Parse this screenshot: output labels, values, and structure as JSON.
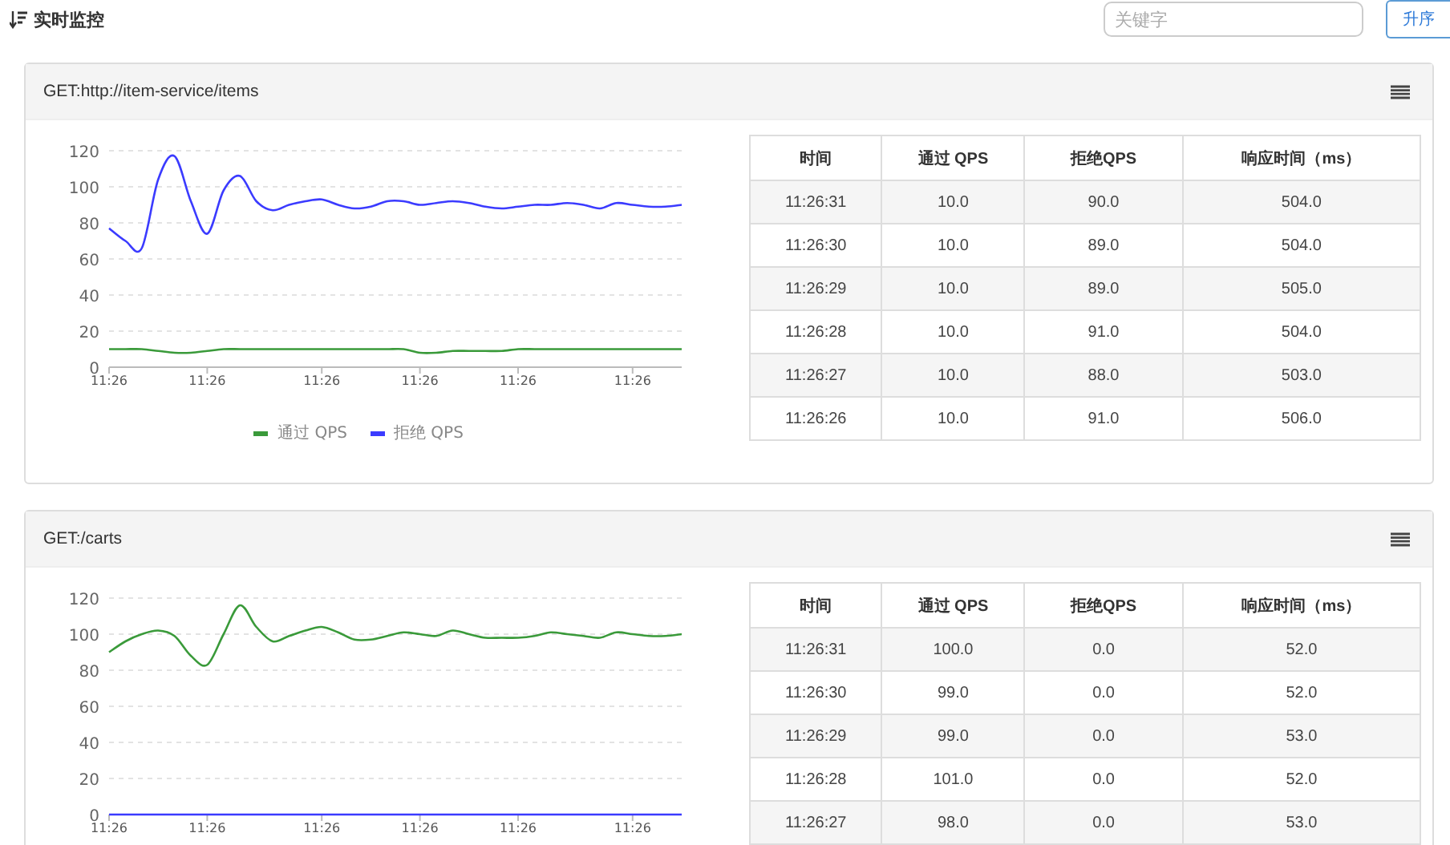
{
  "header": {
    "title": "实时监控",
    "search": {
      "placeholder": "关键字"
    },
    "sort_button": "升序"
  },
  "resources": [
    {
      "name": "GET:http://item-service/items",
      "chart_data": {
        "type": "line",
        "grid": true,
        "categories": [
          "11:26",
          null,
          null,
          null,
          null,
          null,
          "11:26",
          null,
          null,
          null,
          null,
          null,
          null,
          "11:26",
          null,
          null,
          null,
          null,
          null,
          "11:26",
          null,
          null,
          null,
          null,
          null,
          "11:26",
          null,
          null,
          null,
          null,
          null,
          null,
          "11:26",
          null,
          null,
          null
        ],
        "ylim": [
          0,
          120
        ],
        "yticks": [
          0,
          20,
          40,
          60,
          80,
          100,
          120
        ],
        "series": [
          {
            "name": "通过 QPS",
            "color": "#3a9a3a",
            "values": [
              10,
              10,
              10,
              9,
              8,
              8,
              9,
              10,
              10,
              10,
              10,
              10,
              10,
              10,
              10,
              10,
              10,
              10,
              10,
              8,
              8,
              9,
              9,
              9,
              9,
              10,
              10,
              10,
              10,
              10,
              10,
              10,
              10,
              10,
              10,
              10
            ]
          },
          {
            "name": "拒绝 QPS",
            "color": "#3b3bff",
            "values": [
              77,
              70,
              66,
              104,
              117,
              92,
              74,
              98,
              106,
              92,
              87,
              90,
              92,
              93,
              90,
              88,
              89,
              92,
              92,
              90,
              91,
              92,
              91,
              89,
              88,
              89,
              90,
              90,
              91,
              90,
              88,
              91,
              90,
              89,
              89,
              90
            ]
          }
        ]
      },
      "table": {
        "columns": [
          "时间",
          "通过 QPS",
          "拒绝QPS",
          "响应时间（ms）"
        ],
        "rows": [
          [
            "11:26:31",
            "10.0",
            "90.0",
            "504.0"
          ],
          [
            "11:26:30",
            "10.0",
            "89.0",
            "504.0"
          ],
          [
            "11:26:29",
            "10.0",
            "89.0",
            "505.0"
          ],
          [
            "11:26:28",
            "10.0",
            "91.0",
            "504.0"
          ],
          [
            "11:26:27",
            "10.0",
            "88.0",
            "503.0"
          ],
          [
            "11:26:26",
            "10.0",
            "91.0",
            "506.0"
          ]
        ]
      }
    },
    {
      "name": "GET:/carts",
      "chart_data": {
        "type": "line",
        "grid": true,
        "categories": [
          "11:26",
          null,
          null,
          null,
          null,
          null,
          "11:26",
          null,
          null,
          null,
          null,
          null,
          null,
          "11:26",
          null,
          null,
          null,
          null,
          null,
          "11:26",
          null,
          null,
          null,
          null,
          null,
          "11:26",
          null,
          null,
          null,
          null,
          null,
          null,
          "11:26",
          null,
          null,
          null
        ],
        "ylim": [
          0,
          120
        ],
        "yticks": [
          0,
          20,
          40,
          60,
          80,
          100,
          120
        ],
        "series": [
          {
            "color": "#3a9a3a",
            "values": [
              90,
              96,
              100,
              102,
              99,
              88,
              83,
              100,
              116,
              104,
              96,
              99,
              102,
              104,
              101,
              97,
              97,
              99,
              101,
              100,
              99,
              102,
              100,
              98,
              98,
              98,
              99,
              101,
              100,
              99,
              98,
              101,
              100,
              99,
              99,
              100
            ]
          },
          {
            "color": "#3b3bff",
            "values": [
              0,
              0,
              0,
              0,
              0,
              0,
              0,
              0,
              0,
              0,
              0,
              0,
              0,
              0,
              0,
              0,
              0,
              0,
              0,
              0,
              0,
              0,
              0,
              0,
              0,
              0,
              0,
              0,
              0,
              0,
              0,
              0,
              0,
              0,
              0,
              0
            ]
          }
        ]
      },
      "table": {
        "columns": [
          "时间",
          "通过 QPS",
          "拒绝QPS",
          "响应时间（ms）"
        ],
        "rows": [
          [
            "11:26:31",
            "100.0",
            "0.0",
            "52.0"
          ],
          [
            "11:26:30",
            "99.0",
            "0.0",
            "52.0"
          ],
          [
            "11:26:29",
            "99.0",
            "0.0",
            "53.0"
          ],
          [
            "11:26:28",
            "101.0",
            "0.0",
            "52.0"
          ],
          [
            "11:26:27",
            "98.0",
            "0.0",
            "53.0"
          ]
        ]
      }
    }
  ]
}
